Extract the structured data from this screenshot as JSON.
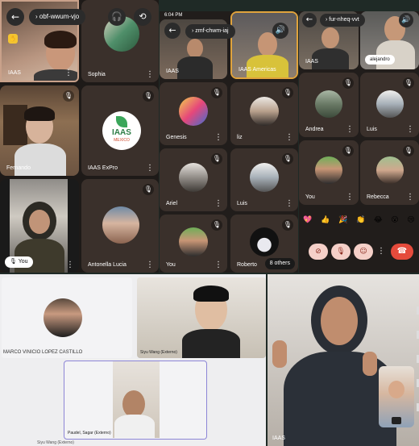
{
  "panel1": {
    "meeting_code": "obf-wwum-vjo",
    "tiles": [
      {
        "label": "IAAS"
      },
      {
        "label": "Sophia"
      },
      {
        "label": "Fernando"
      },
      {
        "label": "IAAS ExPro",
        "logo_text": "IAAS",
        "logo_sub": "MEXICO"
      },
      {
        "label": "You"
      },
      {
        "label": "Antonella Lucia"
      }
    ]
  },
  "panel2": {
    "status_time": "6:04 PM",
    "meeting_code": "zmf-chwm-iaj",
    "tiles": [
      {
        "label": "IAAS"
      },
      {
        "label": "IAAS Americas"
      },
      {
        "label": "Genesis"
      },
      {
        "label": "liz"
      },
      {
        "label": "Ariel"
      },
      {
        "label": "Luis"
      },
      {
        "label": "You"
      },
      {
        "label": "Roberto"
      }
    ],
    "others_label": "8 others"
  },
  "panel3": {
    "meeting_code": "fur-nheq-vvt",
    "tiles": [
      {
        "label": "IAAS"
      },
      {
        "label": "alejandro"
      },
      {
        "label": "Andrea"
      },
      {
        "label": "Luis"
      },
      {
        "label": "You"
      },
      {
        "label": "Rebecca"
      }
    ],
    "reactions": [
      "💖",
      "👍",
      "🎉",
      "👏",
      "😂",
      "😮",
      "😢"
    ]
  },
  "panel4": {
    "tiles": [
      {
        "label": "MARCO VINICIO LOPEZ CASTILLO"
      },
      {
        "label": "Siyu Wang (Externo)"
      },
      {
        "label": "Paudel, Sagar (Externo)"
      },
      {
        "label": "Siyu Wang (Externo)"
      }
    ]
  },
  "panel5": {
    "label": "IAAS"
  },
  "colors": {
    "tile_dark": "#3a302b",
    "end_call": "#e54b3c",
    "meet_bg": "#211d1b",
    "light_bg": "#eeeef0",
    "selected_border": "#8c85d6"
  }
}
